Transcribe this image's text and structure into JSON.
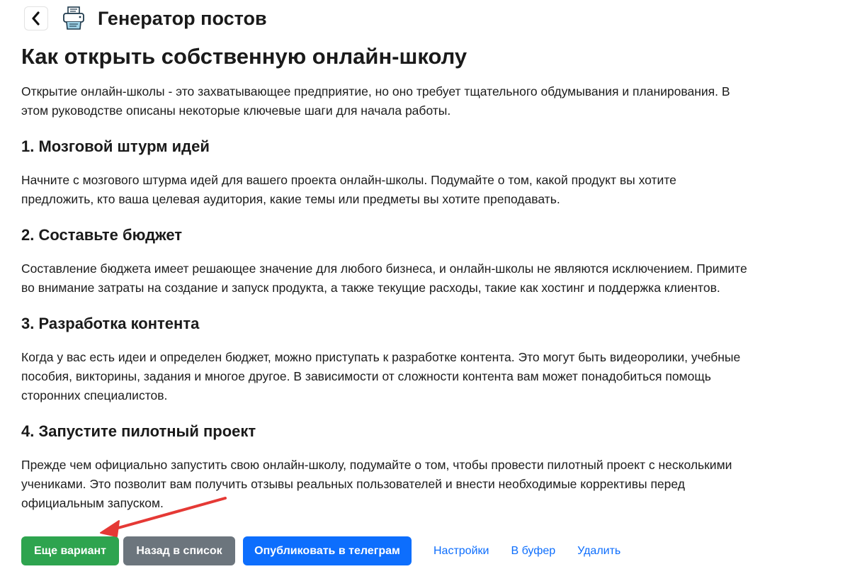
{
  "header": {
    "back_icon": "chevron-left-icon",
    "logo_icon": "printer-icon",
    "title": "Генератор постов"
  },
  "article": {
    "title": "Как открыть собственную онлайн-школу",
    "intro": "Открытие онлайн-школы - это захватывающее предприятие, но оно требует тщательного обдумывания и планирования. В этом руководстве описаны некоторые ключевые шаги для начала работы.",
    "sections": [
      {
        "heading": "1. Мозговой штурм идей",
        "text": "Начните с мозгового штурма идей для вашего проекта онлайн-школы. Подумайте о том, какой продукт вы хотите предложить, кто ваша целевая аудитория, какие темы или предметы вы хотите преподавать."
      },
      {
        "heading": "2. Составьте бюджет",
        "text": "Составление бюджета имеет решающее значение для любого бизнеса, и онлайн-школы не являются исключением. Примите во внимание затраты на создание и запуск продукта, а также текущие расходы, такие как хостинг и поддержка клиентов."
      },
      {
        "heading": "3. Разработка контента",
        "text": "Когда у вас есть идеи и определен бюджет, можно приступать к разработке контента. Это могут быть видеоролики, учебные пособия, викторины, задания и многое другое. В зависимости от сложности контента вам может понадобиться помощь сторонних специалистов."
      },
      {
        "heading": "4. Запустите пилотный проект",
        "text": "Прежде чем официально запустить свою онлайн-школу, подумайте о том, чтобы провести пилотный проект с несколькими учениками. Это позволит вам получить отзывы реальных пользователей и внести необходимые коррективы перед официальным запуском."
      }
    ]
  },
  "actions": {
    "another_variant": "Еще вариант",
    "back_to_list": "Назад в список",
    "publish_telegram": "Опубликовать в телеграм",
    "settings": "Настройки",
    "to_buffer": "В буфер",
    "delete": "Удалить"
  },
  "colors": {
    "green": "#2ea44f",
    "gray": "#6c757d",
    "blue": "#0d6efd",
    "link": "#0d6efd",
    "annotation_arrow": "#e53935"
  }
}
